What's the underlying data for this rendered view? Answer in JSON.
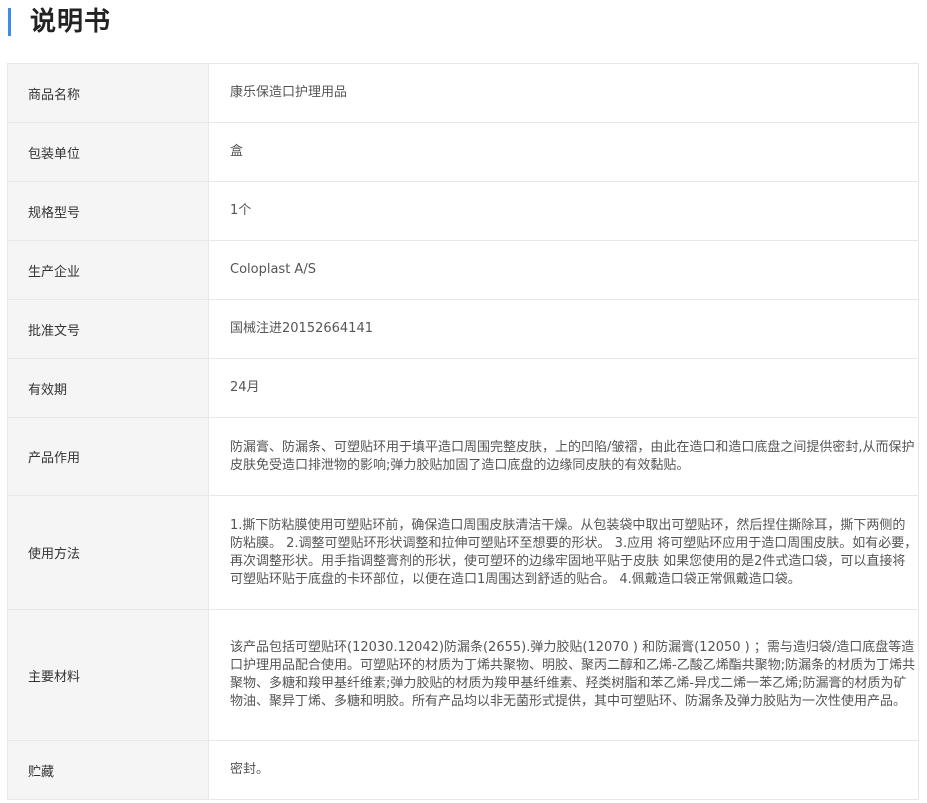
{
  "heading": {
    "title": "说明书",
    "accent_color": "#3a8ee6"
  },
  "spec_rows": [
    {
      "label": "商品名称",
      "value": "康乐保造口护理用品"
    },
    {
      "label": "包装单位",
      "value": "盒"
    },
    {
      "label": "规格型号",
      "value": "1个"
    },
    {
      "label": "生产企业",
      "value": "Coloplast A/S"
    },
    {
      "label": "批准文号",
      "value": "国械注进20152664141"
    },
    {
      "label": "有效期",
      "value": "24月"
    },
    {
      "label": "产品作用",
      "value": "防漏膏、防漏条、可塑贴环用于填平造口周围完整皮肤，上的凹陷/皱褶，由此在造口和造口底盘之间提供密封,从而保护皮肤免受造口排泄物的影响;弹力胶贴加固了造口底盘的边缘同皮肤的有效黏贴。"
    },
    {
      "label": "使用方法",
      "value": "1.撕下防粘膜使用可塑贴环前，确保造口周围皮肤清洁干燥。从包装袋中取出可塑贴环，然后捏住撕除耳，撕下两侧的防粘膜。 2.调整可塑贴环形状调整和拉伸可塑贴环至想要的形状。 3.应用 将可塑贴环应用于造口周围皮肤。如有必要，再次调整形状。用手指调整膏剂的形状，使可塑环的边缘牢固地平贴于皮肤 如果您使用的是2件式造口袋，可以直接将可塑贴环贴于底盘的卡环部位，以便在造口1周围达到舒适的贴合。 4.佩戴造口袋正常佩戴造口袋。"
    },
    {
      "label": "主要材料",
      "value": "该产品包括可塑贴环(12030.12042)防漏条(2655).弹力胶贴(12070 ) 和防漏膏(12050 ) ；需与造归袋/造口底盘等造口护理用品配合使用。可塑贴环的材质为丁烯共聚物、明胶、聚丙二醇和乙烯-乙酸乙烯酯共聚物;防漏条的材质为丁烯共聚物、多糖和羧甲基纤维素;弹力胶贴的材质为羧甲基纤维素、羟类树脂和苯乙烯-异戊二烯一苯乙烯;防漏膏的材质为矿物油、聚异丁烯、多糖和明胶。所有产品均以非无菌形式提供，其中可塑贴环、防漏条及弹力胶贴为一次性使用产品。"
    },
    {
      "label": "贮藏",
      "value": "密封。"
    }
  ]
}
